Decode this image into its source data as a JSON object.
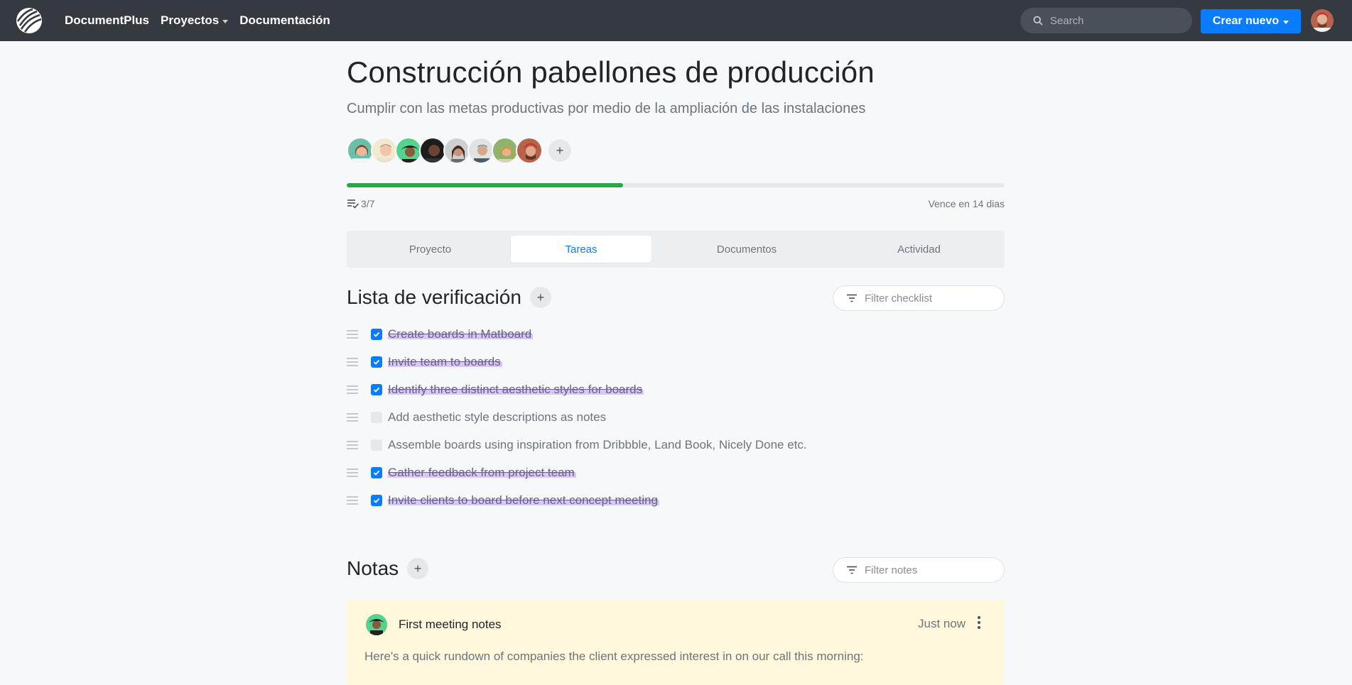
{
  "navbar": {
    "brand": "DocumentPlus",
    "projects": "Proyectos",
    "docs": "Documentación",
    "search_placeholder": "Search",
    "create_label": "Crear nuevo"
  },
  "project": {
    "title": "Construcción pabellones de producción",
    "subtitle": "Cumplir con las metas productivas por medio de la ampliación de las instalaciones",
    "progress_fraction": 0.42,
    "tasks_count": "3/7",
    "due": "Vence en 14 dias"
  },
  "tabs": [
    {
      "label": "Proyecto"
    },
    {
      "label": "Tareas"
    },
    {
      "label": "Documentos"
    },
    {
      "label": "Actividad"
    }
  ],
  "checklist": {
    "title": "Lista de verificación",
    "filter_placeholder": "Filter checklist",
    "items": [
      {
        "text": "Create boards in Matboard",
        "done": true
      },
      {
        "text": "Invite team to boards",
        "done": true
      },
      {
        "text": "Identify three distinct aesthetic styles for boards",
        "done": true
      },
      {
        "text": "Add aesthetic style descriptions as notes",
        "done": false
      },
      {
        "text": "Assemble boards using inspiration from Dribbble, Land Book, Nicely Done etc.",
        "done": false
      },
      {
        "text": "Gather feedback from project team",
        "done": true
      },
      {
        "text": "Invite clients to board before next concept meeting",
        "done": true
      }
    ]
  },
  "notes": {
    "title": "Notas",
    "filter_placeholder": "Filter notes",
    "card": {
      "title": "First meeting notes",
      "time": "Just now",
      "body": "Here's a quick rundown of companies the client expressed interest in on our call this morning:"
    }
  },
  "colors": {
    "navbar": "#343a40",
    "accent": "#0a7cff",
    "progress": "#28a745",
    "highlight": "#d9c8f5",
    "note_bg": "#fff8dc"
  }
}
